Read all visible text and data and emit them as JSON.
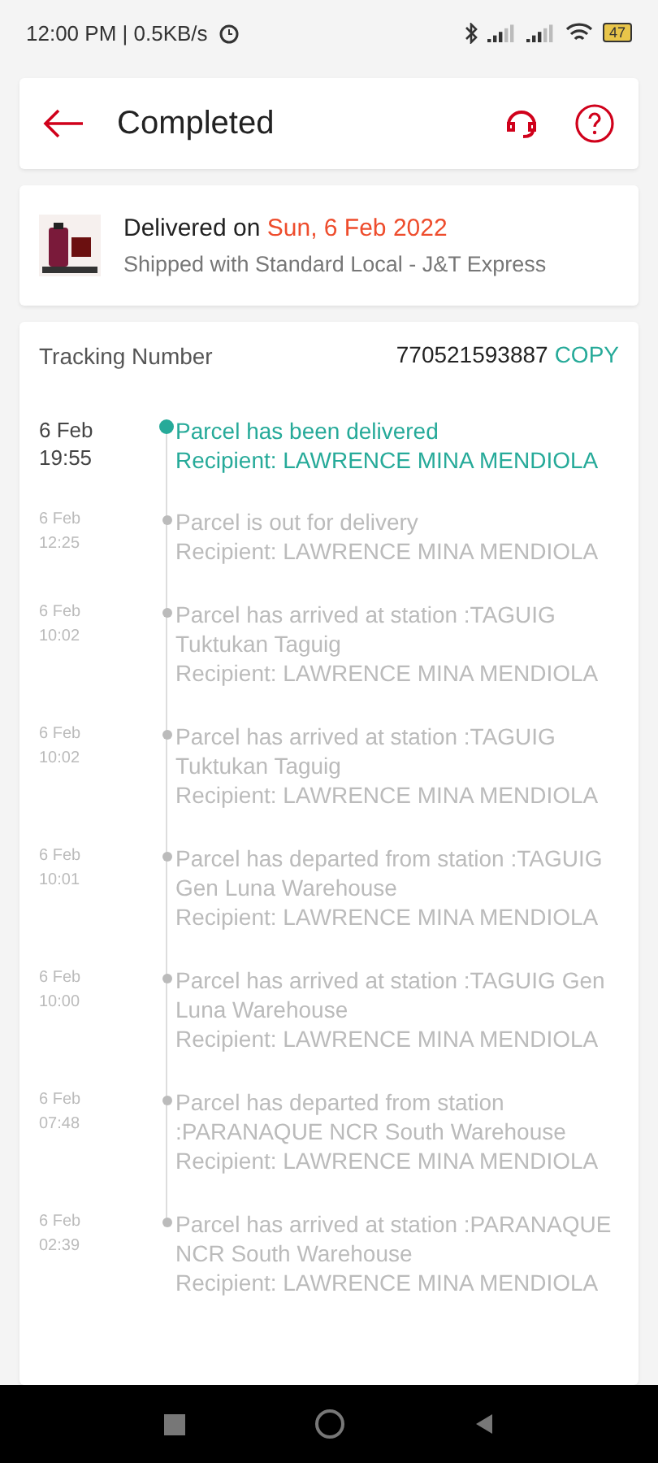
{
  "status_bar": {
    "time": "12:00 PM | 0.5KB/s",
    "battery": "47"
  },
  "header": {
    "title": "Completed"
  },
  "shipment": {
    "label": "Delivered on",
    "date": "Sun, 6 Feb 2022",
    "carrier": "Shipped with Standard Local - J&T Express"
  },
  "tracking": {
    "label": "Tracking Number",
    "number": "770521593887",
    "copy": "COPY"
  },
  "events": [
    {
      "date": "6 Feb",
      "time": "19:55",
      "title": "Parcel has been delivered",
      "recipient": "Recipient: LAWRENCE MINA MENDIOLA",
      "selected": true
    },
    {
      "date": "6 Feb",
      "time": "12:25",
      "title": "Parcel is out for delivery",
      "recipient": "Recipient: LAWRENCE MINA MENDIOLA",
      "selected": false
    },
    {
      "date": "6 Feb",
      "time": "10:02",
      "title": "Parcel has arrived at station :TAGUIG Tuktukan Taguig",
      "recipient": "Recipient: LAWRENCE MINA MENDIOLA",
      "selected": false
    },
    {
      "date": "6 Feb",
      "time": "10:02",
      "title": "Parcel has arrived at station :TAGUIG Tuktukan Taguig",
      "recipient": "Recipient: LAWRENCE MINA MENDIOLA",
      "selected": false
    },
    {
      "date": "6 Feb",
      "time": "10:01",
      "title": "Parcel has departed from station :TAGUIG Gen Luna Warehouse",
      "recipient": "Recipient: LAWRENCE MINA MENDIOLA",
      "selected": false
    },
    {
      "date": "6 Feb",
      "time": "10:00",
      "title": "Parcel has arrived at station :TAGUIG Gen Luna Warehouse",
      "recipient": "Recipient: LAWRENCE MINA MENDIOLA",
      "selected": false
    },
    {
      "date": "6 Feb",
      "time": "07:48",
      "title": "Parcel has departed from station :PARANAQUE NCR South Warehouse",
      "recipient": "Recipient: LAWRENCE MINA MENDIOLA",
      "selected": false
    },
    {
      "date": "6 Feb",
      "time": "02:39",
      "title": "Parcel has arrived at station :PARANAQUE NCR South Warehouse",
      "recipient": "Recipient: LAWRENCE MINA MENDIOLA",
      "selected": false
    }
  ]
}
